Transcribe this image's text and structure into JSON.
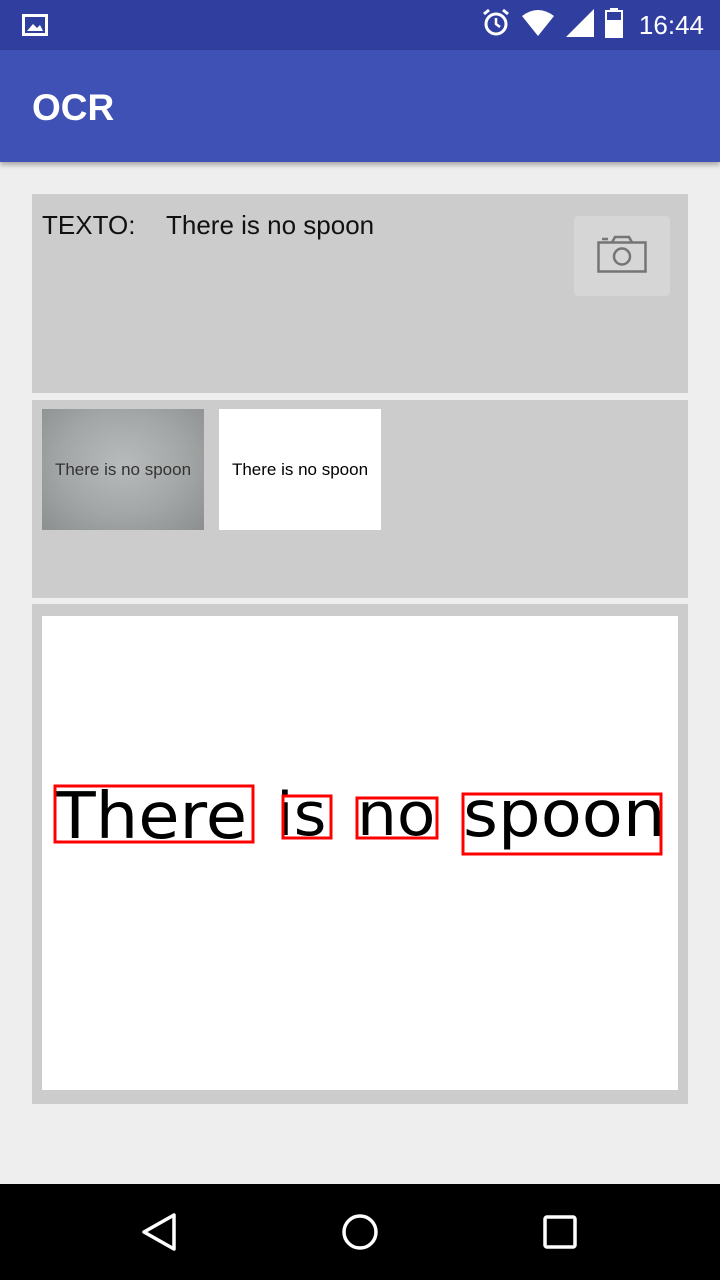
{
  "status_bar": {
    "time": "16:44",
    "icons": [
      "gallery-icon",
      "alarm-icon",
      "wifi-icon",
      "signal-icon",
      "battery-icon"
    ]
  },
  "app_bar": {
    "title": "OCR"
  },
  "text_panel": {
    "label": "TEXTO:",
    "value": "There is no spoon",
    "camera_icon": "camera-icon"
  },
  "thumbnails": {
    "original_text": "There is no spoon",
    "binarized_text": "There is no spoon"
  },
  "result": {
    "words": [
      "There",
      "is",
      "no",
      "spoon"
    ],
    "box_color": "#ff0000"
  },
  "nav_bar": {
    "icons": [
      "back-icon",
      "home-icon",
      "recents-icon"
    ]
  },
  "colors": {
    "status_bar": "#303f9f",
    "app_bar": "#3f51b5",
    "panel": "#cccccc",
    "background": "#eeeeee"
  }
}
